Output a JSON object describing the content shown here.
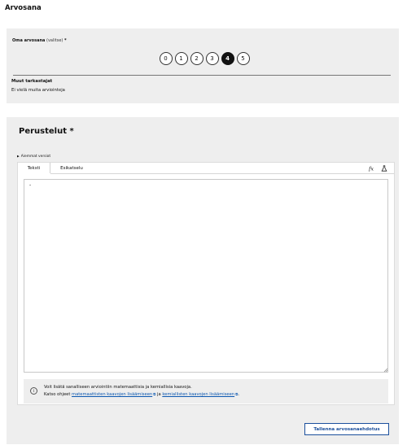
{
  "page": {
    "title": "Arvosana"
  },
  "grade": {
    "label": "Oma arvosana",
    "hint": "(valitse)",
    "required_mark": "*",
    "options": [
      "0",
      "1",
      "2",
      "3",
      "4",
      "5"
    ],
    "selected": "4"
  },
  "others": {
    "title": "Muut tarkastajat",
    "text": "Ei vielä muita arviointeja"
  },
  "reasons": {
    "title": "Perustelut *",
    "previous_versions": "Aiemmat versiot",
    "tabs": [
      {
        "label": "Teksti",
        "active": true
      },
      {
        "label": "Esikatselu",
        "active": false
      }
    ],
    "icons": [
      "formula-icon",
      "chemistry-icon"
    ],
    "editor_value": "-",
    "info": {
      "line1": "Voit lisätä sanalliseen arviointiin matemaattisia ja kemiallisia kaavoja.",
      "line2_prefix": "Katso ohjeet",
      "link1": "matemaattisten kaavojen lisäämiseen",
      "connector": "ja",
      "link2": "kemiallisten kaavojen lisäämiseen",
      "suffix": "."
    },
    "save_label": "Tallenna arvosanaehdotus"
  },
  "colors": {
    "panel_bg": "#eeeeee",
    "link": "#0b57b0",
    "button_border": "#1b4f9c",
    "selected_grade": "#111111"
  }
}
